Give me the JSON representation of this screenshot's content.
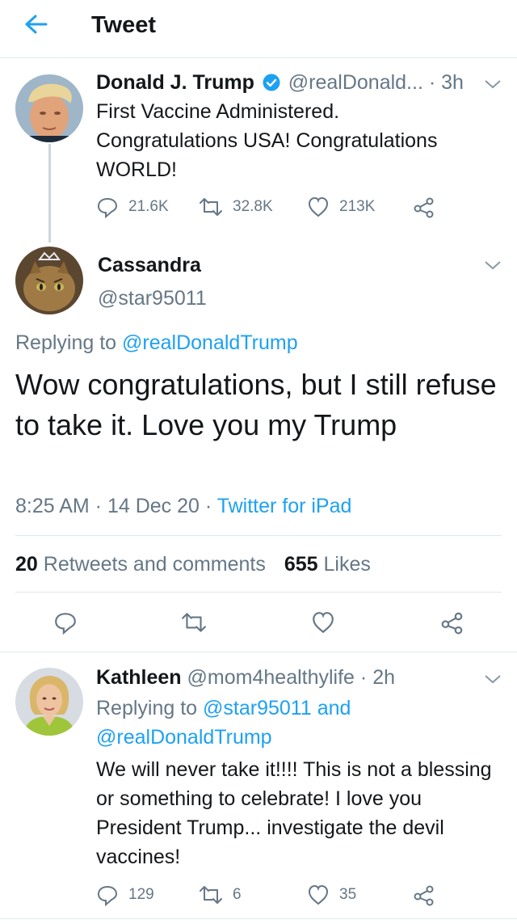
{
  "header": {
    "title": "Tweet",
    "back_icon": "arrow-left-icon"
  },
  "colors": {
    "accent": "#1da1f2",
    "text": "#14171a",
    "secondary": "#657786",
    "divider": "#e1e8ed",
    "verified": "#1da1f2"
  },
  "parent_tweet": {
    "name": "Donald J. Trump",
    "verified": true,
    "handle": "@realDonald...",
    "time_sep": " · ",
    "time": "3h",
    "text": "First Vaccine Administered. Congratulations USA! Congratulations WORLD!",
    "replies": "21.6K",
    "retweets": "32.8K",
    "likes": "213K"
  },
  "main_tweet": {
    "name": "Cassandra",
    "handle": "@star95011",
    "replying_prefix": "Replying to ",
    "replying_to": "@realDonaldTrump",
    "text": "Wow congratulations, but I still refuse to take it. Love you my Trump",
    "time": "8:25 AM",
    "sep": " · ",
    "date": "14 Dec 20",
    "source": "Twitter for iPad",
    "retweets_count": "20",
    "retweets_label": " Retweets and comments",
    "likes_count": "655",
    "likes_label": " Likes"
  },
  "reply_tweet": {
    "name": "Kathleen",
    "handle": "@mom4healthylife",
    "time_sep": " · ",
    "time": "2h",
    "replying_prefix": "Replying to ",
    "replying_to": "@star95011 and @realDonaldTrump",
    "text": "We will never take it!!!! This is not a blessing or something to celebrate! I love you President Trump... investigate the devil vaccines!",
    "replies": "129",
    "retweets": "6",
    "likes": "35"
  }
}
